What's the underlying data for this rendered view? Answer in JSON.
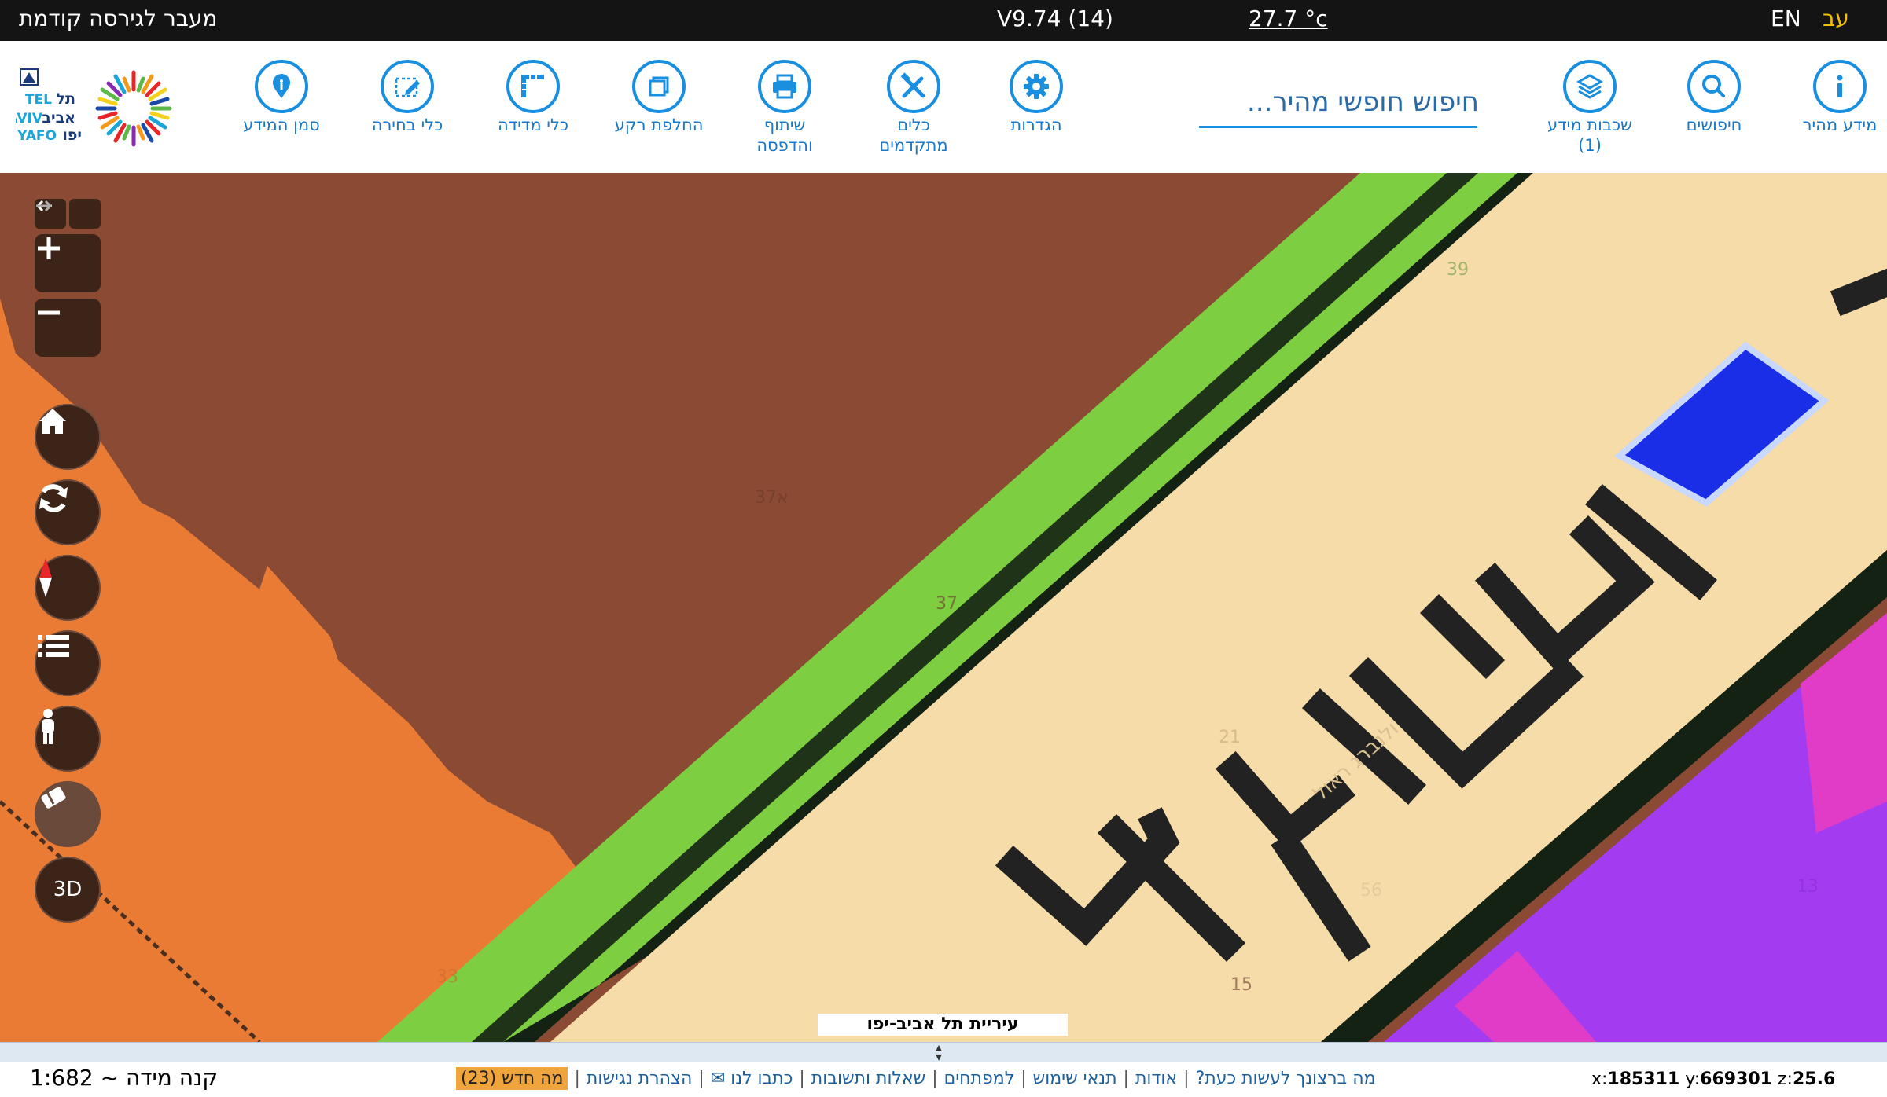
{
  "topbar": {
    "prev_version": "מעבר לגירסה קודמת",
    "version": "V9.74 (14)",
    "temperature": "27.7 °c",
    "lang_en": "EN",
    "lang_he": "עב"
  },
  "toolbar": {
    "tools": [
      {
        "id": "quick-info",
        "label": "מידע מהיר",
        "icon": "info-icon"
      },
      {
        "id": "searches",
        "label": "חיפושים",
        "icon": "search-icon"
      },
      {
        "id": "layers",
        "label": "שכבות מידע\n(1)",
        "icon": "layers-icon"
      },
      {
        "id": "settings",
        "label": "הגדרות",
        "icon": "gear-icon"
      },
      {
        "id": "advanced-tools",
        "label": "כלים\nמתקדמים",
        "icon": "tools-icon"
      },
      {
        "id": "share-print",
        "label": "שיתוף\nוהדפסה",
        "icon": "printer-icon"
      },
      {
        "id": "basemap",
        "label": "החלפת רקע",
        "icon": "basemap-icon"
      },
      {
        "id": "measure",
        "label": "כלי מדידה",
        "icon": "ruler-icon"
      },
      {
        "id": "select",
        "label": "כלי בחירה",
        "icon": "pen-select-icon"
      },
      {
        "id": "info-marker",
        "label": "סמן המידע",
        "icon": "map-pin-icon"
      }
    ],
    "search_placeholder": "חיפוש חופשי מהיר...",
    "logo": {
      "line1": "תל",
      "line2": "TEL",
      "line3": "אביב",
      "line4": "AVIV",
      "line5": "YAFO",
      "line6": "יפו"
    }
  },
  "map": {
    "city_label": "עיריית תל אביב-יפו",
    "three_d_label": "3D",
    "parcel_labels": [
      "37א",
      "37",
      "39",
      "21",
      "15",
      "13",
      "33",
      "56"
    ],
    "street_label": "ולנברג ראול",
    "colors": {
      "brown": "#8b4a34",
      "orange": "#e97b35",
      "green": "#7dce40",
      "beige": "#f5dca9",
      "purple": "#a33cf0",
      "magenta": "#e13cc8",
      "blue": "#1a2ee8",
      "dark": "#142214"
    }
  },
  "footer": {
    "scale": "קנה מידה ~ 1:682",
    "coords": {
      "x_label": "x:",
      "x": "185311",
      "y_label": "y:",
      "y": "669301",
      "z_label": "z:",
      "z": "25.6"
    },
    "links": [
      "מה ברצונך לעשות כעת?",
      "אודות",
      "תנאי שימוש",
      "למפתחים",
      "שאלות ותשובות",
      "כתבו לנו ✉",
      "הצהרת נגישות"
    ],
    "whats_new": "מה חדש (23)"
  }
}
